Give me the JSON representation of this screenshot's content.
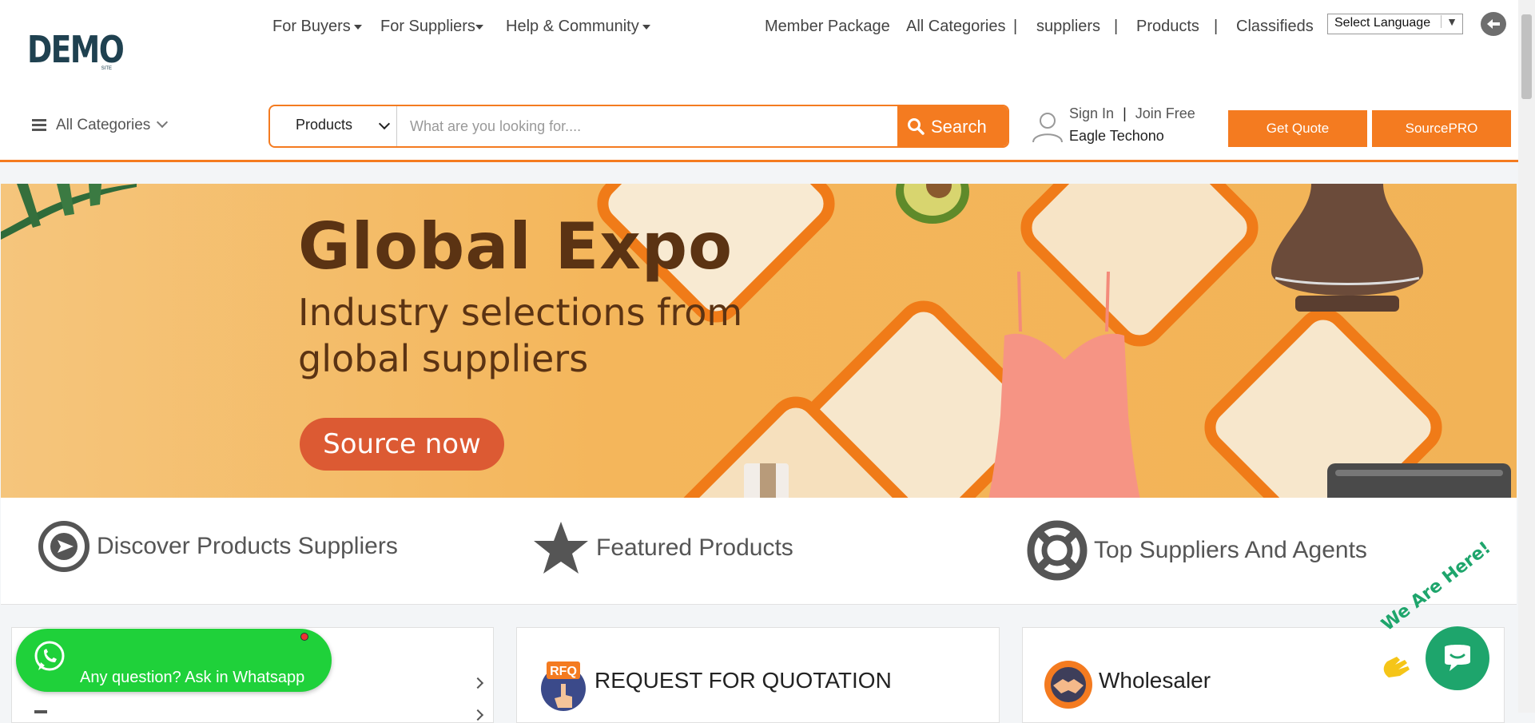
{
  "logo": {
    "text": "DEMO",
    "sub": "SITE"
  },
  "nav": {
    "for_buyers": "For Buyers",
    "for_suppliers": "For Suppliers",
    "help": "Help & Community",
    "member_package": "Member Package",
    "all_categories": "All Categories",
    "suppliers": "suppliers",
    "products": "Products",
    "classifieds": "Classifieds",
    "separator": "|"
  },
  "language": {
    "label": "Select Language",
    "arrow": "▼"
  },
  "back_icon": "arrow-left-icon",
  "categories_menu": {
    "label": "All Categories"
  },
  "search": {
    "category": "Products",
    "placeholder": "What are you looking for....",
    "button": "Search"
  },
  "account": {
    "sign_in": "Sign In",
    "separator": "|",
    "join": "Join Free",
    "username": "Eagle Techono"
  },
  "buttons": {
    "get_quote": "Get Quote",
    "sourcepro": "SourcePRO"
  },
  "banner": {
    "title": "Global Expo",
    "subtitle_line1": "Industry selections from",
    "subtitle_line2": "global suppliers",
    "cta": "Source now"
  },
  "features": [
    {
      "label": "Discover Products Suppliers",
      "icon": "compass-icon"
    },
    {
      "label": "Featured Products",
      "icon": "star-icon"
    },
    {
      "label": "Top Suppliers And Agents",
      "icon": "lifebuoy-icon"
    }
  ],
  "cards": {
    "rfq_title": "REQUEST FOR QUOTATION",
    "rfq_badge": "RFQ",
    "wholesaler_title": "Wholesaler"
  },
  "whatsapp": {
    "text": "Any question? Ask in Whatsapp"
  },
  "chat": {
    "badge": "We Are Here!"
  },
  "colors": {
    "accent": "#f47b20",
    "whatsapp": "#1fd13a",
    "chat": "#1ea56c",
    "logo": "#1f4150"
  }
}
